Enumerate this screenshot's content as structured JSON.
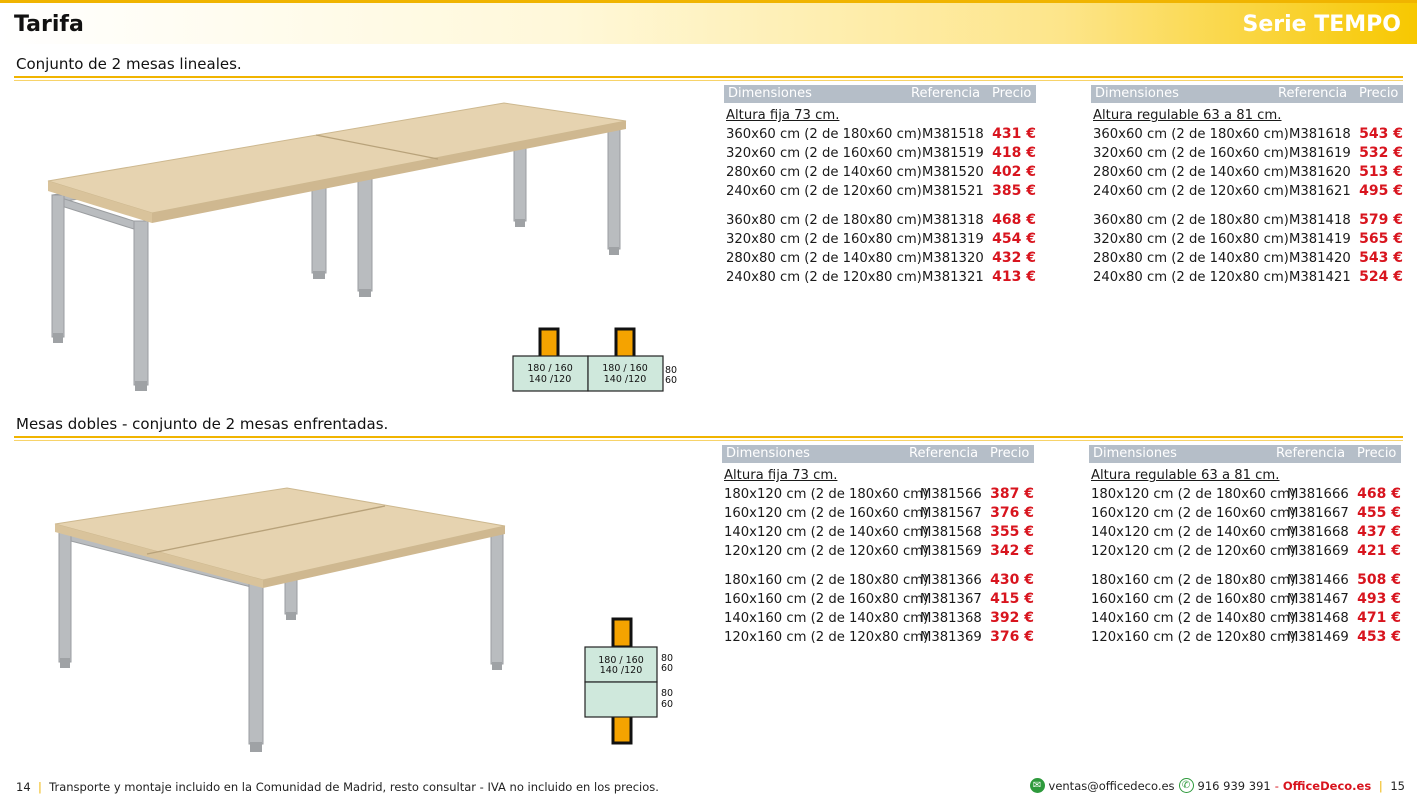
{
  "header": {
    "title": "Tarifa",
    "series": "Serie TEMPO"
  },
  "colors": {
    "accent": "#f0b400",
    "price": "#d8141e",
    "table_header": "#b5bec8",
    "layout_fill": "#cfe8dc",
    "leg_block": "#f5a300"
  },
  "sections": [
    {
      "title": "Conjunto de 2 mesas lineales.",
      "tables": [
        {
          "headers": {
            "dim": "Dimensiones",
            "ref": "Referencia",
            "price": "Precio"
          },
          "subtitle": "Altura fija 73 cm.",
          "rows": [
            {
              "dim": "360x60 cm (2 de 180x60 cm)",
              "ref": "M381518",
              "price": "431 €"
            },
            {
              "dim": "320x60 cm (2 de 160x60 cm)",
              "ref": "M381519",
              "price": "418 €"
            },
            {
              "dim": "280x60 cm (2 de 140x60 cm)",
              "ref": "M381520",
              "price": "402 €"
            },
            {
              "dim": "240x60 cm (2 de 120x60 cm)",
              "ref": "M381521",
              "price": "385 €"
            },
            {
              "dim": "360x80 cm (2 de 180x80 cm)",
              "ref": "M381318",
              "price": "468 €"
            },
            {
              "dim": "320x80 cm (2 de 160x80 cm)",
              "ref": "M381319",
              "price": "454 €"
            },
            {
              "dim": "280x80 cm (2 de 140x80 cm)",
              "ref": "M381320",
              "price": "432 €"
            },
            {
              "dim": "240x80 cm (2 de 120x80 cm)",
              "ref": "M381321",
              "price": "413 €"
            }
          ]
        },
        {
          "headers": {
            "dim": "Dimensiones",
            "ref": "Referencia",
            "price": "Precio"
          },
          "subtitle": "Altura regulable 63 a 81 cm.",
          "rows": [
            {
              "dim": "360x60 cm (2 de 180x60 cm)",
              "ref": "M381618",
              "price": "543 €"
            },
            {
              "dim": "320x60 cm (2 de 160x60 cm)",
              "ref": "M381619",
              "price": "532 €"
            },
            {
              "dim": "280x60 cm (2 de 140x60 cm)",
              "ref": "M381620",
              "price": "513 €"
            },
            {
              "dim": "240x60 cm (2 de 120x60 cm)",
              "ref": "M381621",
              "price": "495 €"
            },
            {
              "dim": "360x80 cm (2 de 180x80 cm)",
              "ref": "M381418",
              "price": "579 €"
            },
            {
              "dim": "320x80 cm (2 de 160x80 cm)",
              "ref": "M381419",
              "price": "565 €"
            },
            {
              "dim": "280x80 cm (2 de 140x80 cm)",
              "ref": "M381420",
              "price": "543 €"
            },
            {
              "dim": "240x80 cm (2 de 120x80 cm)",
              "ref": "M381421",
              "price": "524 €"
            }
          ]
        }
      ],
      "layout": {
        "box_label_a": "180 / 160",
        "box_label_b": "140 /120",
        "depth_a": "80",
        "depth_b": "60"
      }
    },
    {
      "title": "Mesas dobles - conjunto de 2 mesas enfrentadas.",
      "tables": [
        {
          "headers": {
            "dim": "Dimensiones",
            "ref": "Referencia",
            "price": "Precio"
          },
          "subtitle": "Altura fija 73 cm.",
          "rows": [
            {
              "dim": "180x120 cm (2 de 180x60 cm)",
              "ref": "M381566",
              "price": "387 €"
            },
            {
              "dim": "160x120 cm (2 de 160x60 cm)",
              "ref": "M381567",
              "price": "376 €"
            },
            {
              "dim": "140x120 cm (2 de 140x60 cm)",
              "ref": "M381568",
              "price": "355 €"
            },
            {
              "dim": "120x120 cm (2 de 120x60 cm)",
              "ref": "M381569",
              "price": "342 €"
            },
            {
              "dim": "180x160 cm (2 de 180x80 cm)",
              "ref": "M381366",
              "price": "430 €"
            },
            {
              "dim": "160x160 cm (2 de 160x80 cm)",
              "ref": "M381367",
              "price": "415 €"
            },
            {
              "dim": "140x160 cm (2 de 140x80 cm)",
              "ref": "M381368",
              "price": "392 €"
            },
            {
              "dim": "120x160 cm (2 de 120x80 cm)",
              "ref": "M381369",
              "price": "376 €"
            }
          ]
        },
        {
          "headers": {
            "dim": "Dimensiones",
            "ref": "Referencia",
            "price": "Precio"
          },
          "subtitle": "Altura regulable 63 a 81 cm.",
          "rows": [
            {
              "dim": "180x120 cm (2 de 180x60 cm)",
              "ref": "M381666",
              "price": "468 €"
            },
            {
              "dim": "160x120 cm (2 de 160x60 cm)",
              "ref": "M381667",
              "price": "455 €"
            },
            {
              "dim": "140x120 cm (2 de 140x60 cm)",
              "ref": "M381668",
              "price": "437 €"
            },
            {
              "dim": "120x120 cm (2 de 120x60 cm)",
              "ref": "M381669",
              "price": "421 €"
            },
            {
              "dim": "180x160 cm (2 de 180x80 cm)",
              "ref": "M381466",
              "price": "508 €"
            },
            {
              "dim": "160x160 cm (2 de 160x80 cm)",
              "ref": "M381467",
              "price": "493 €"
            },
            {
              "dim": "140x160 cm (2 de 140x80 cm)",
              "ref": "M381468",
              "price": "471 €"
            },
            {
              "dim": "120x160 cm (2 de 120x80 cm)",
              "ref": "M381469",
              "price": "453 €"
            }
          ]
        }
      ],
      "layout": {
        "box_label_a": "180 / 160",
        "box_label_b": "140 /120",
        "depth_a": "80",
        "depth_b": "60"
      }
    }
  ],
  "footer": {
    "page_left": "14",
    "note": "Transporte y montaje incluido en la Comunidad de Madrid, resto consultar - IVA no incluido en los precios.",
    "email_icon": "email-icon",
    "email": "ventas@officedeco.es",
    "phone_icon": "phone-icon",
    "phone": "916 939 391",
    "separator": "-",
    "brand": "OfficeDeco.es",
    "page_right": "15"
  }
}
